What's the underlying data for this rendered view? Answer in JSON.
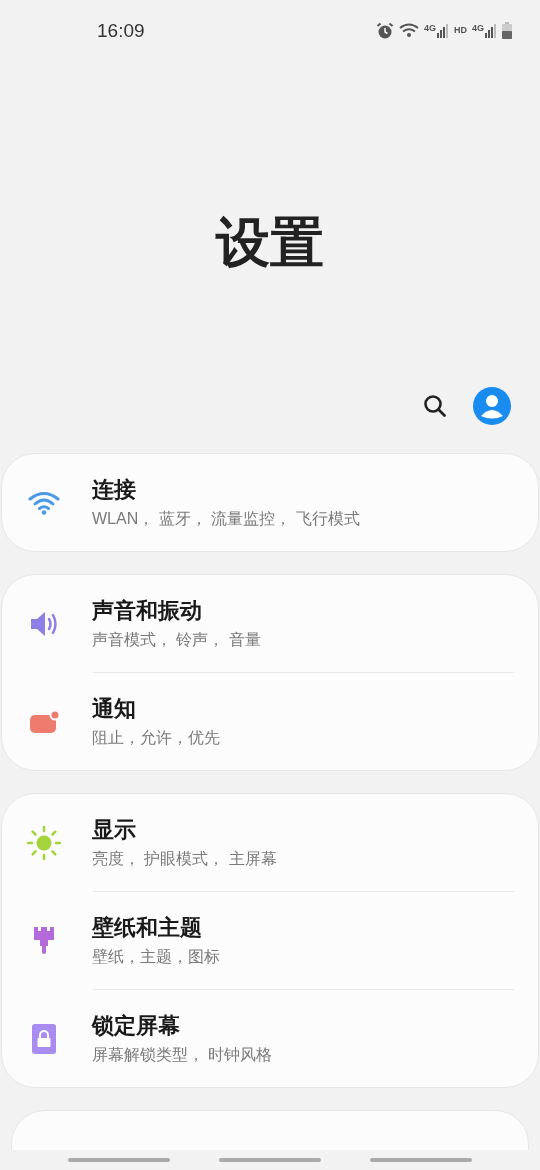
{
  "status_bar": {
    "time": "16:09",
    "network_labels": [
      "4G",
      "HD",
      "4G"
    ]
  },
  "title": "设置",
  "groups": [
    {
      "items": [
        {
          "kind": "wifi",
          "title": "连接",
          "subtitle": "WLAN， 蓝牙， 流量监控， 飞行模式"
        }
      ]
    },
    {
      "items": [
        {
          "kind": "sound",
          "title": "声音和振动",
          "subtitle": "声音模式， 铃声， 音量"
        },
        {
          "kind": "notification",
          "title": "通知",
          "subtitle": "阻止，允许，优先"
        }
      ]
    },
    {
      "items": [
        {
          "kind": "display",
          "title": "显示",
          "subtitle": "亮度， 护眼模式， 主屏幕"
        },
        {
          "kind": "wallpaper",
          "title": "壁纸和主题",
          "subtitle": "壁纸，主题，图标"
        },
        {
          "kind": "lock",
          "title": "锁定屏幕",
          "subtitle": "屏幕解锁类型， 时钟风格"
        }
      ]
    }
  ]
}
